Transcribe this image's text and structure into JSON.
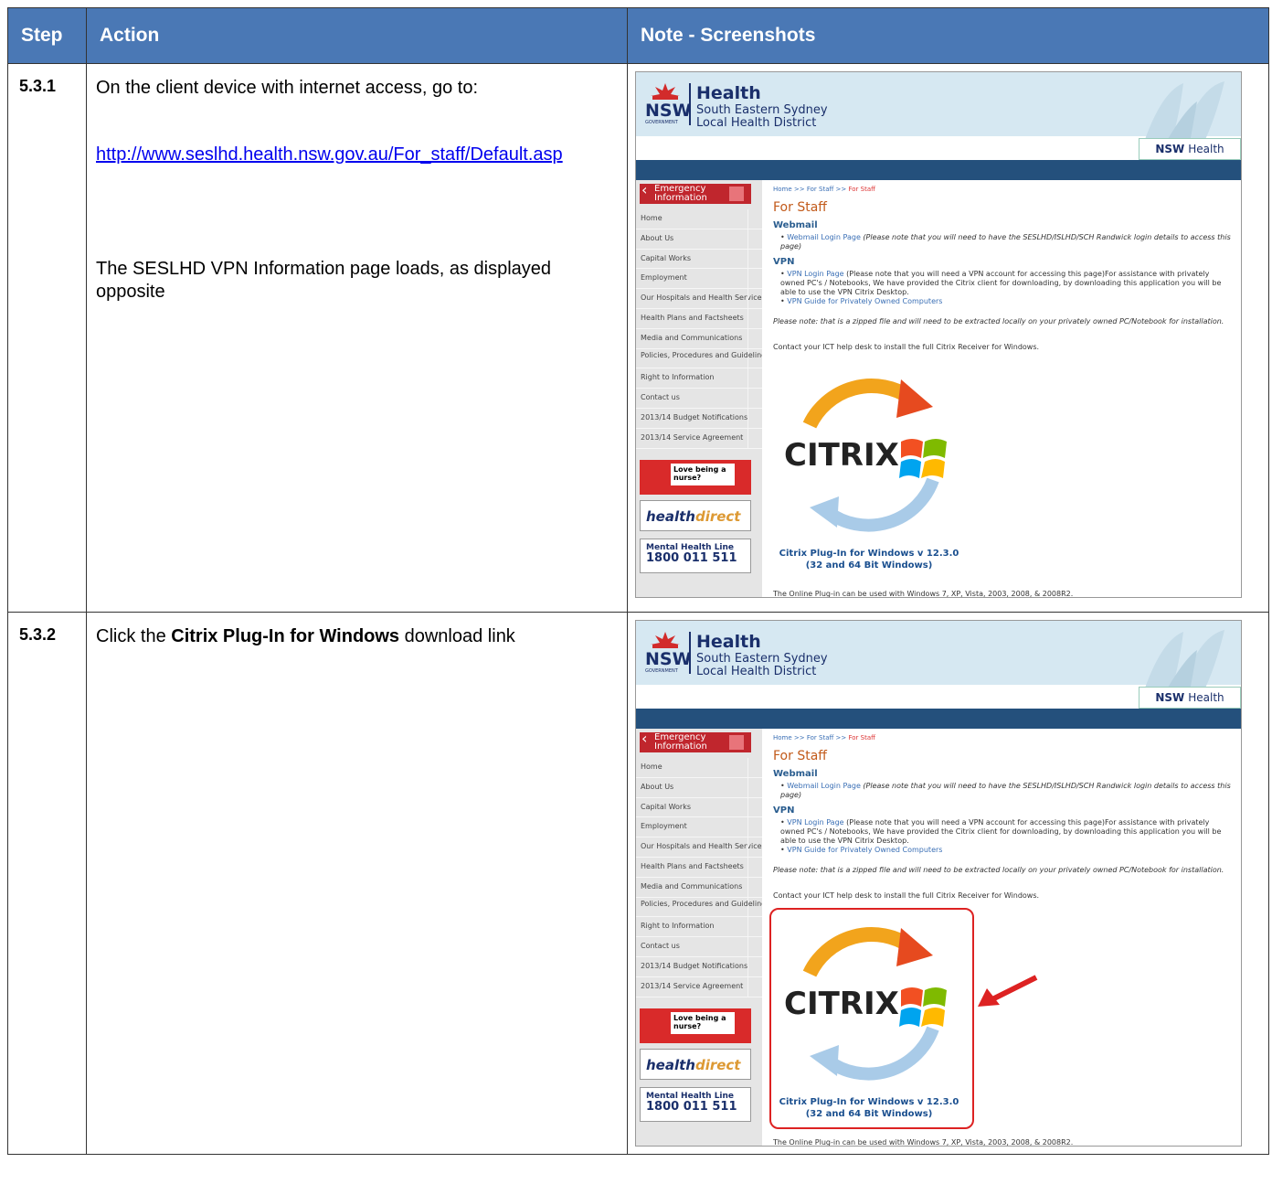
{
  "header": {
    "step": "Step",
    "action": "Action",
    "note": "Note - Screenshots"
  },
  "rows": [
    {
      "step": "5.3.1",
      "line1": "On the client device with internet access, go to:",
      "link": "http://www.seslhd.health.nsw.gov.au/For_staff/Default.asp",
      "line2": "The SESLHD VPN Information page loads, as displayed opposite"
    },
    {
      "step": "5.3.2",
      "pre": "Click the ",
      "bold": "Citrix Plug-In for Windows",
      "post": " download link"
    }
  ],
  "site": {
    "health": "Health",
    "district1": "South Eastern Sydney",
    "district2": "Local Health District",
    "nsw": "NSW",
    "gov": "GOVERNMENT",
    "tab_bold": "NSW",
    "tab_rest": "Health",
    "emergency": "Emergency Information",
    "nav": [
      "Home",
      "About Us",
      "Capital Works",
      "Employment",
      "Our Hospitals and Health Services",
      "Health Plans and Factsheets",
      "Media and Communications",
      "Policies, Procedures and Guidelines",
      "Right to Information",
      "Contact us",
      "2013/14 Budget Notifications",
      "2013/14 Service Agreement"
    ],
    "ad_nurse": "Love being a nurse?",
    "ad_hd1": "health",
    "ad_hd2": "direct",
    "ad_mh1": "Mental Health Line",
    "ad_mh2": "1800 011 511",
    "crumb": "Home >> For Staff >> ",
    "crumb_cur": "For Staff",
    "title": "For Staff",
    "webmail": "Webmail",
    "webmail_link": "Webmail Login Page",
    "webmail_note": " (Please note that you will need to have the SESLHD/ISLHD/SCH Randwick login details to access this page)",
    "vpn": "VPN",
    "vpn_link": "VPN Login Page",
    "vpn_note": " (Please note that you will need a VPN account for accessing this page)For assistance with privately owned PC's / Notebooks, We have provided the Citrix client for downloading, by downloading this application you will be able to use the VPN Citrix Desktop.",
    "vpn_guide": "VPN Guide for Privately Owned Computers",
    "zip_note": "Please note: that is a zipped file and will need to be extracted locally on your privately owned PC/Notebook for installation.",
    "contact": "Contact your ICT help desk to install the full Citrix Receiver for Windows.",
    "citrix_logo": "CITRIX",
    "plugin1": "Citrix Plug-In for Windows v 12.3.0",
    "plugin2": "(32 and 64 Bit Windows)",
    "online": "The Online Plug-in can be used with Windows 7, XP, Vista, 2003, 2008, & 2008R2."
  }
}
